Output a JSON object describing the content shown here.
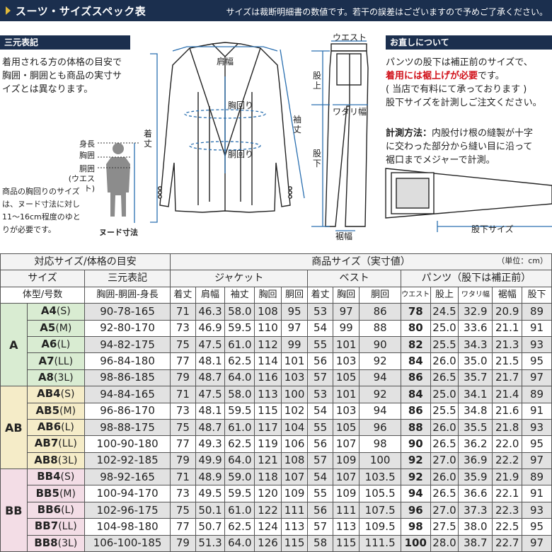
{
  "header": {
    "title": "スーツ・サイズスペック表",
    "note": "サイズは裁断明細書の数値です。若干の誤差はございますので予めご了承ください。"
  },
  "left": {
    "section": "三元表記",
    "text": [
      "着用される方の体格の目安で",
      "胸囲・胴囲とも商品の実寸サ",
      "イズとは異なります。"
    ],
    "body_labels": [
      "身長",
      "胸囲",
      "胴囲",
      "(ウエスト)"
    ],
    "note": [
      "商品の胸回りのサイズ",
      "は、ヌード寸法に対し",
      "11〜16cm程度のゆと",
      "りが必要です。"
    ],
    "nude_label": "ヌード寸法"
  },
  "jacket_labels": {
    "shoulder": "肩幅",
    "chest": "胸回り",
    "waist": "胴回り",
    "length": "着丈",
    "sleeve": "袖丈"
  },
  "pants_labels": {
    "waist": "ウエスト",
    "rise": "股上",
    "thigh": "ワタリ幅",
    "inseam": "股下",
    "hem": "裾幅"
  },
  "right": {
    "section": "お直しについて",
    "text1": "パンツの股下は補正前のサイズで、",
    "text2_red": "着用には裾上げが必要",
    "text2_tail": "です。",
    "text3": "( 当店で有料にて承っております )",
    "text4": "股下サイズを計測しご注文ください。",
    "measure_bold": "計測方法：",
    "measure1": "内股付け根の縫製が十字",
    "measure2": "に交わった部分から縫い目に沿って",
    "measure3": "裾口までメジャーで計測。",
    "inseam_label": "股下サイズ"
  },
  "table": {
    "unit": "（単位：cm）",
    "h1": [
      "対応サイズ/体格の目安",
      "商品サイズ（実寸値）"
    ],
    "h2": [
      "サイズ",
      "三元表記",
      "ジャケット",
      "ベスト",
      "パンツ（股下は補正前）"
    ],
    "h3": [
      "体型/号数",
      "胸囲-胴囲-身長",
      "着丈",
      "肩幅",
      "袖丈",
      "胸回",
      "胴回",
      "着丈",
      "胸回",
      "胴回",
      "ウエスト",
      "股上",
      "ワタリ幅",
      "裾幅",
      "股下"
    ],
    "groups": [
      {
        "name": "A",
        "rows": [
          {
            "size": "A4",
            "sub": "(S)",
            "sangen": "90-78-165",
            "vals": [
              "71",
              "46.3",
              "58.0",
              "108",
              "95",
              "53",
              "97",
              "86",
              "78",
              "24.5",
              "32.9",
              "20.9",
              "89"
            ]
          },
          {
            "size": "A5",
            "sub": "(M)",
            "sangen": "92-80-170",
            "vals": [
              "73",
              "46.9",
              "59.5",
              "110",
              "97",
              "54",
              "99",
              "88",
              "80",
              "25.0",
              "33.6",
              "21.1",
              "91"
            ]
          },
          {
            "size": "A6",
            "sub": "(L)",
            "sangen": "94-82-175",
            "vals": [
              "75",
              "47.5",
              "61.0",
              "112",
              "99",
              "55",
              "101",
              "90",
              "82",
              "25.5",
              "34.3",
              "21.3",
              "93"
            ]
          },
          {
            "size": "A7",
            "sub": "(LL)",
            "sangen": "96-84-180",
            "vals": [
              "77",
              "48.1",
              "62.5",
              "114",
              "101",
              "56",
              "103",
              "92",
              "84",
              "26.0",
              "35.0",
              "21.5",
              "95"
            ]
          },
          {
            "size": "A8",
            "sub": "(3L)",
            "sangen": "98-86-185",
            "vals": [
              "79",
              "48.7",
              "64.0",
              "116",
              "103",
              "57",
              "105",
              "94",
              "86",
              "26.5",
              "35.7",
              "21.7",
              "97"
            ]
          }
        ]
      },
      {
        "name": "AB",
        "rows": [
          {
            "size": "AB4",
            "sub": "(S)",
            "sangen": "94-84-165",
            "vals": [
              "71",
              "47.5",
              "58.0",
              "113",
              "100",
              "53",
              "101",
              "92",
              "84",
              "25.0",
              "34.1",
              "21.4",
              "89"
            ]
          },
          {
            "size": "AB5",
            "sub": "(M)",
            "sangen": "96-86-170",
            "vals": [
              "73",
              "48.1",
              "59.5",
              "115",
              "102",
              "54",
              "103",
              "94",
              "86",
              "25.5",
              "34.8",
              "21.6",
              "91"
            ]
          },
          {
            "size": "AB6",
            "sub": "(L)",
            "sangen": "98-88-175",
            "vals": [
              "75",
              "48.7",
              "61.0",
              "117",
              "104",
              "55",
              "105",
              "96",
              "88",
              "26.0",
              "35.5",
              "21.8",
              "93"
            ]
          },
          {
            "size": "AB7",
            "sub": "(LL)",
            "sangen": "100-90-180",
            "vals": [
              "77",
              "49.3",
              "62.5",
              "119",
              "106",
              "56",
              "107",
              "98",
              "90",
              "26.5",
              "36.2",
              "22.0",
              "95"
            ]
          },
          {
            "size": "AB8",
            "sub": "(3L)",
            "sangen": "102-92-185",
            "vals": [
              "79",
              "49.9",
              "64.0",
              "121",
              "108",
              "57",
              "109",
              "100",
              "92",
              "27.0",
              "36.9",
              "22.2",
              "97"
            ]
          }
        ]
      },
      {
        "name": "BB",
        "rows": [
          {
            "size": "BB4",
            "sub": "(S)",
            "sangen": "98-92-165",
            "vals": [
              "71",
              "48.9",
              "59.0",
              "118",
              "107",
              "54",
              "107",
              "103.5",
              "92",
              "26.0",
              "35.9",
              "21.9",
              "89"
            ]
          },
          {
            "size": "BB5",
            "sub": "(M)",
            "sangen": "100-94-170",
            "vals": [
              "73",
              "49.5",
              "59.5",
              "120",
              "109",
              "55",
              "109",
              "105.5",
              "94",
              "26.5",
              "36.6",
              "22.1",
              "91"
            ]
          },
          {
            "size": "BB6",
            "sub": "(L)",
            "sangen": "102-96-175",
            "vals": [
              "75",
              "50.1",
              "61.0",
              "122",
              "111",
              "56",
              "111",
              "107.5",
              "96",
              "27.0",
              "37.3",
              "22.3",
              "93"
            ]
          },
          {
            "size": "BB7",
            "sub": "(LL)",
            "sangen": "104-98-180",
            "vals": [
              "77",
              "50.7",
              "62.5",
              "124",
              "113",
              "57",
              "113",
              "109.5",
              "98",
              "27.5",
              "38.0",
              "22.5",
              "95"
            ]
          },
          {
            "size": "BB8",
            "sub": "(3L)",
            "sangen": "106-100-185",
            "vals": [
              "79",
              "51.3",
              "64.0",
              "126",
              "115",
              "58",
              "115",
              "111.5",
              "100",
              "28.0",
              "38.7",
              "22.7",
              "97"
            ]
          }
        ]
      }
    ]
  }
}
